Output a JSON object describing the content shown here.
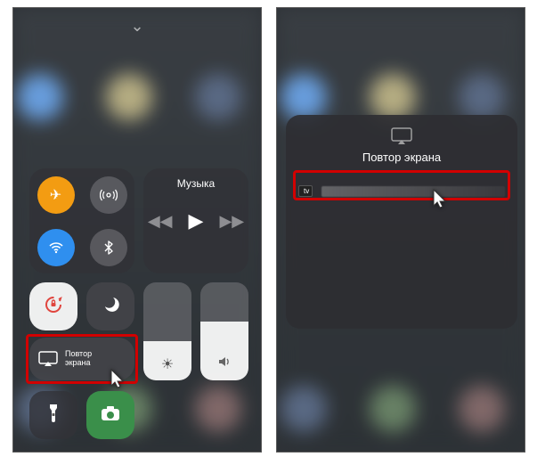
{
  "left": {
    "music_label": "Музыка",
    "mirror_line1": "Повтор",
    "mirror_line2": "экрана"
  },
  "right": {
    "popup_title": "Повтор экрана",
    "device_tag": "tv"
  }
}
